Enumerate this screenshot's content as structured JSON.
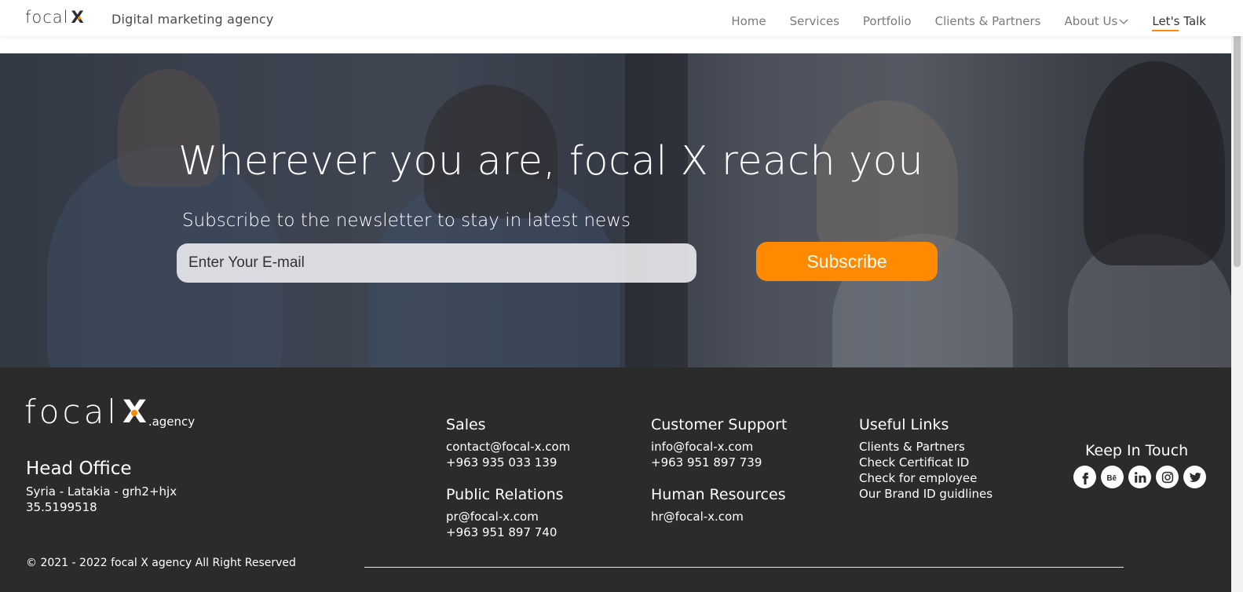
{
  "header": {
    "logo_text": "focal",
    "logo_mark": "X",
    "tagline": "Digital marketing agency",
    "nav": [
      {
        "label": "Home"
      },
      {
        "label": "Services"
      },
      {
        "label": "Portfolio"
      },
      {
        "label": "Clients & Partners"
      },
      {
        "label": "About Us"
      },
      {
        "label": "Let's Talk"
      }
    ]
  },
  "hero": {
    "title": "Wherever you are, focal X reach you",
    "subtitle": "Subscribe to the newsletter to stay in latest news",
    "email_placeholder": "Enter Your E-mail",
    "subscribe_label": "Subscribe"
  },
  "footer": {
    "logo_text": "focal",
    "logo_mark": "X",
    "logo_suffix": ".agency",
    "head_office": {
      "title": "Head Office",
      "address": "Syria - Latakia - grh2+hjx",
      "coords": "35.5199518"
    },
    "sales": {
      "title": "Sales",
      "email": "contact@focal-x.com",
      "phone": "+963 935 033 139"
    },
    "public_relations": {
      "title": "Public Relations",
      "email": "pr@focal-x.com",
      "phone": "+963 951 897 740"
    },
    "customer_support": {
      "title": "Customer Support",
      "email": "info@focal-x.com",
      "phone": "+963 951 897 739"
    },
    "human_resources": {
      "title": "Human Resources",
      "email": "hr@focal-x.com"
    },
    "useful_links": {
      "title": "Useful Links",
      "items": [
        "Clients & Partners",
        "Check Certificat ID",
        "Check for employee",
        "Our Brand ID guidlines"
      ]
    },
    "keep_in_touch": {
      "title": "Keep In Touch",
      "icons": [
        "facebook-icon",
        "behance-icon",
        "linkedin-icon",
        "instagram-icon",
        "twitter-icon"
      ]
    },
    "copyright": "© 2021 - 2022 focal X agency All Right Reserved"
  },
  "colors": {
    "accent": "#ff8a00",
    "footer_bg": "#2b2b2b"
  }
}
